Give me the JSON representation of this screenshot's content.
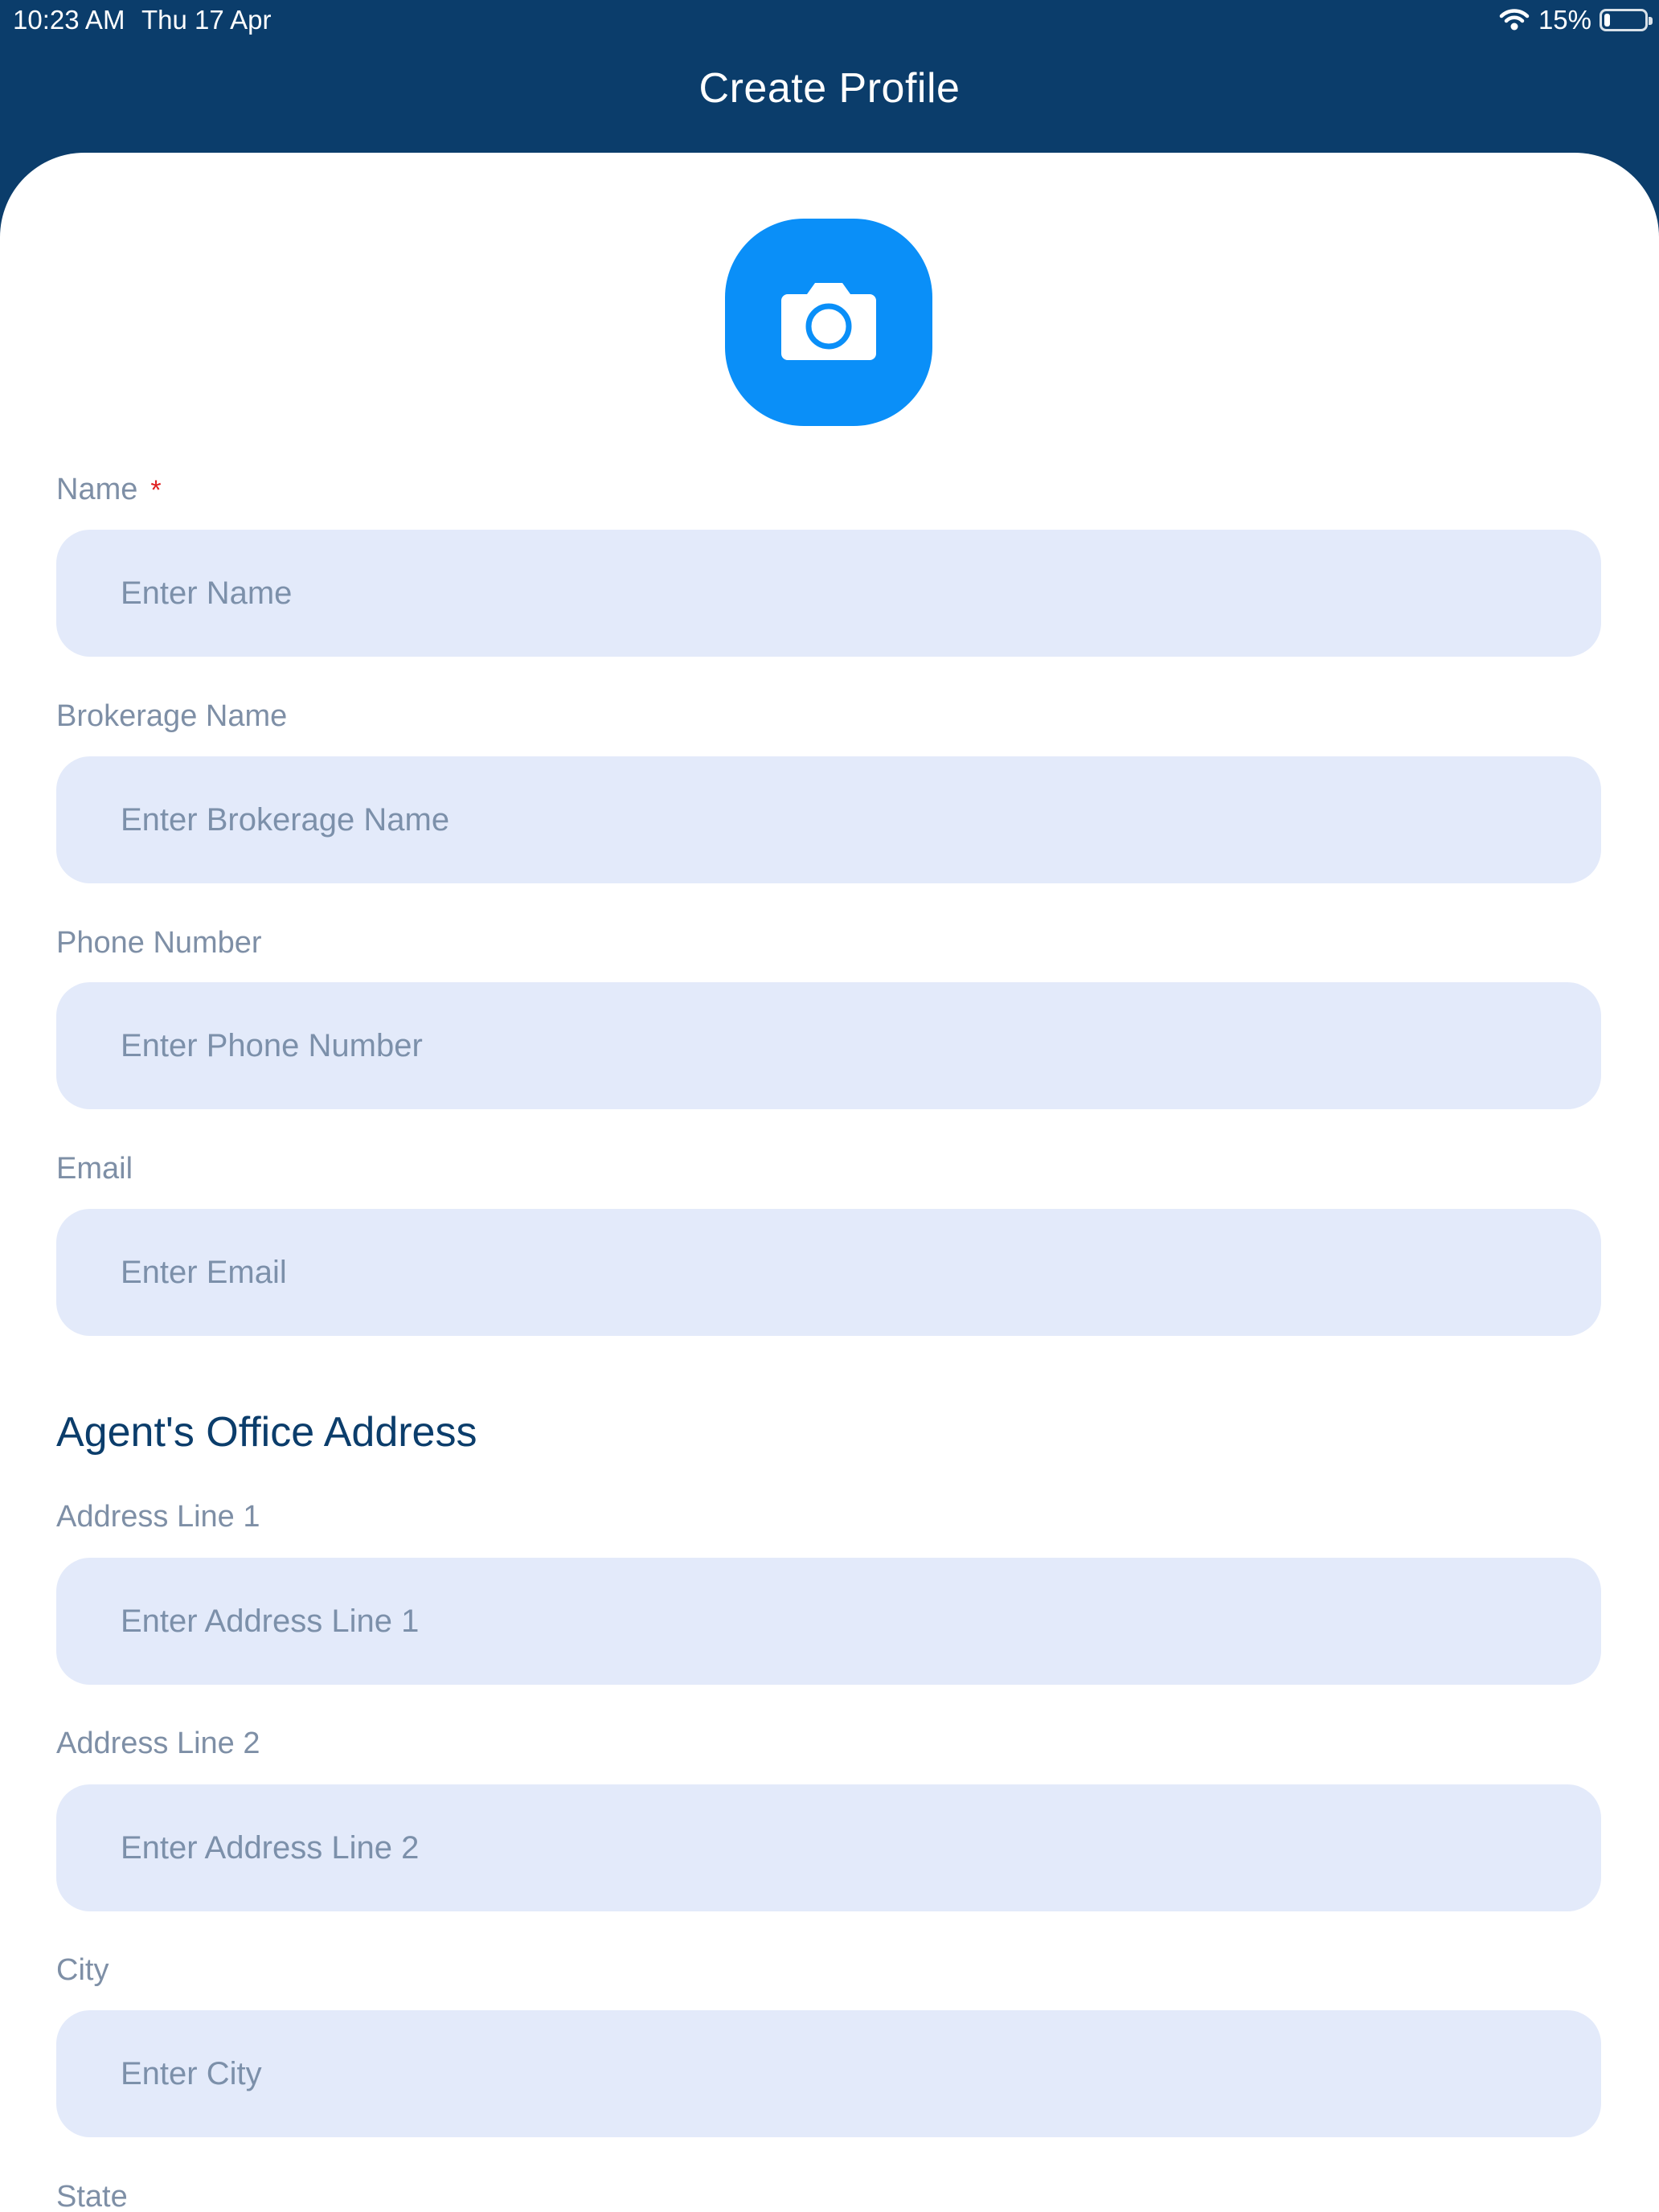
{
  "status_bar": {
    "time": "10:23 AM",
    "date": "Thu 17 Apr",
    "battery_percent": "15%",
    "battery_level": 0.15,
    "wifi_icon": "wifi-icon",
    "battery_icon": "battery-icon"
  },
  "header": {
    "title": "Create Profile",
    "background_color": "#0b3d6b"
  },
  "avatar": {
    "icon": "camera-icon",
    "accent_color": "#0a8ff8"
  },
  "form": {
    "name": {
      "label": "Name",
      "required_mark": "*",
      "placeholder": "Enter Name",
      "value": ""
    },
    "brokerage": {
      "label": "Brokerage Name",
      "placeholder": "Enter Brokerage Name",
      "value": ""
    },
    "phone": {
      "label": "Phone Number",
      "placeholder": "Enter Phone Number",
      "value": ""
    },
    "email": {
      "label": "Email",
      "placeholder": "Enter Email",
      "value": ""
    },
    "office_section_title": "Agent's Office Address",
    "address1": {
      "label": "Address Line 1",
      "placeholder": "Enter Address Line 1",
      "value": ""
    },
    "address2": {
      "label": "Address Line 2",
      "placeholder": "Enter Address Line 2",
      "value": ""
    },
    "city": {
      "label": "City",
      "placeholder": "Enter City",
      "value": ""
    },
    "state": {
      "label": "State"
    }
  }
}
